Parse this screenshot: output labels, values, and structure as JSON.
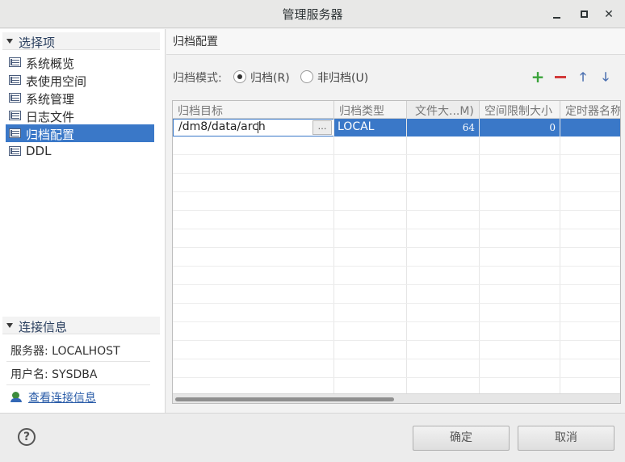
{
  "window": {
    "title": "管理服务器"
  },
  "left": {
    "options_header": "选择项",
    "items": [
      {
        "label": "系统概览"
      },
      {
        "label": "表使用空间"
      },
      {
        "label": "系统管理"
      },
      {
        "label": "日志文件"
      },
      {
        "label": "归档配置",
        "selected": true
      },
      {
        "label": "DDL"
      }
    ],
    "conn_header": "连接信息",
    "server": "服务器: LOCALHOST",
    "user": "用户名: SYSDBA",
    "view_link": "查看连接信息"
  },
  "right": {
    "title": "归档配置",
    "mode_label": "归档模式:",
    "radio_archive": "归档(R)",
    "radio_noarchive": "非归档(U)",
    "selected_mode": "archive",
    "toolbar": {
      "add_icon": "plus-icon",
      "remove_icon": "minus-icon",
      "up_icon": "arrow-up-icon",
      "down_icon": "arrow-down-icon"
    },
    "table": {
      "columns": [
        "归档目标",
        "归档类型",
        "文件大...M)",
        "空间限制大小",
        "定时器名称"
      ],
      "rows": [
        {
          "dest": "/dm8/data/arch",
          "type": "LOCAL",
          "file_size": "64",
          "space_limit": "0",
          "timer": ""
        }
      ]
    }
  },
  "footer": {
    "ok": "确定",
    "cancel": "取消"
  },
  "colors": {
    "selection": "#3a78c8",
    "add": "#3aa33a",
    "remove": "#d23a3a"
  }
}
